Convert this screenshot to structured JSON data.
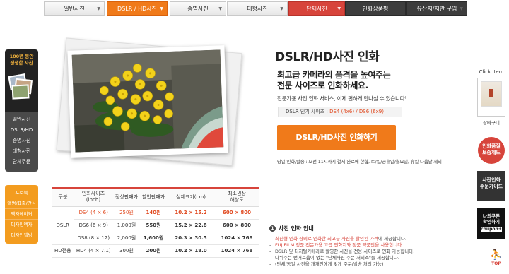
{
  "topnav": {
    "tabs": [
      {
        "label": "일반사진",
        "has_arrow": true
      },
      {
        "label": "DSLR / HD사진",
        "has_arrow": true
      },
      {
        "label": "증명사진",
        "has_arrow": true
      },
      {
        "label": "대형사진",
        "has_arrow": true
      },
      {
        "label": "단체사진",
        "has_arrow": true
      },
      {
        "label": "인화상품평",
        "has_arrow": false
      },
      {
        "label": "유산지/지관 구입",
        "has_arrow": true
      }
    ],
    "arrow_glyph": "▼"
  },
  "leftbar": {
    "promo_text": "100년 동안\n생생한 사진",
    "menu": [
      "일반사진",
      "DSLR/HD",
      "증명사진",
      "대형사진",
      "단체주문"
    ],
    "menu2": [
      "포토북",
      "앨범/표출/간식",
      "액자메이커",
      "디자인액자",
      "디자인앨범"
    ]
  },
  "main": {
    "title": "DSLR/HD사진 인화",
    "subtitle": "최고급 카메라의 품격을 높여주는\n전문 사이즈로 인화하세요.",
    "description": "전문가용 사진 인화 서비스, 이제 편하게 만나실 수 있습니다!",
    "size_label": "DSLR 인기 사이즈 : ",
    "size_values": "DS4 (4x6) / DS6 (6x9)",
    "cta": "DSLR/HD사진 인화하기",
    "notice": "당일 인화/발송 : 오전 11시까지 결제 완료에 한함, 토/일/공휴일/월요일, 휴일 다음날 제외"
  },
  "price_table": {
    "headers": [
      "구분",
      "인화사이즈\n(inch)",
      "정상판매가",
      "할인판매가",
      "실제크기(cm)",
      "최소권장\n해상도"
    ],
    "groups": [
      {
        "label": "DSLR",
        "rows": [
          {
            "size": "DS4 (4 × 6)",
            "regular": "250원",
            "sale": "140원",
            "real": "10.2 × 15.2",
            "res": "600 × 800",
            "highlight": true
          },
          {
            "size": "DS6 (6 × 9)",
            "regular": "1,000원",
            "sale": "550원",
            "real": "15.2 × 22.8",
            "res": "600 × 800",
            "highlight": false
          },
          {
            "size": "DS8 (8 × 12)",
            "regular": "2,000원",
            "sale": "1,600원",
            "real": "20.3 × 30.5",
            "res": "1024 × 768",
            "highlight": false
          }
        ]
      },
      {
        "label": "HD전용",
        "rows": [
          {
            "size": "HD4 (4 × 7.1)",
            "regular": "300원",
            "sale": "200원",
            "real": "10.2 × 18.0",
            "res": "1024 × 768",
            "highlight": false
          }
        ]
      }
    ]
  },
  "info": {
    "number": "1",
    "title": "사진 인화 안내",
    "items": [
      {
        "pre": "",
        "red": "최신형 인화 장비로 인화한 최고급 사진을 할인된 가격",
        "post": "에 제공합니다."
      },
      {
        "pre": "",
        "red": "FUJIFILM 정품 전문가용 고급 인화지와 정품 약품만을 사용합니다.",
        "post": ""
      },
      {
        "pre": "DSLR 및 디지털카메라로 촬영한 사진을 전용 사이즈로 인화 가능합니다.",
        "red": "",
        "post": ""
      },
      {
        "pre": "나뉘주는 번거로움이 없는 \"단체사진 주문 서비스\"를 제공합니다.",
        "red": "",
        "post": ""
      },
      {
        "pre": "(단체/동일 사진을 개개인에게 맞게 주문/발송 처리 가능)",
        "red": "",
        "post": ""
      }
    ]
  },
  "rightbar": {
    "click_item_title": "Click Item",
    "cart_label": "장바구니",
    "circle_text": "인화품질\n보증제도",
    "guide_text": "사진인화\n주문가이드",
    "coupon_text": "나의쿠폰\n확인하기",
    "coupon_tag": "coupon+",
    "top_label": "TOP"
  },
  "colors": {
    "accent_orange": "#f07a1a",
    "accent_red": "#d7443b",
    "sidebar_dark": "#4a4a4a",
    "sidebar_orange": "#f39c1f"
  }
}
